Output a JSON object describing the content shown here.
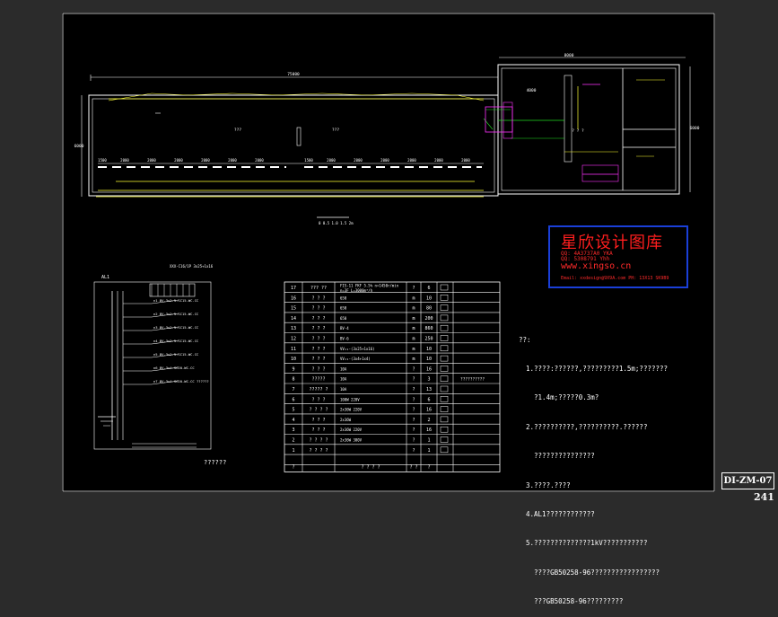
{
  "watermark": {
    "title": "星欣设计图库",
    "line1": "QQ: 4A3737A0 YKA",
    "line2": "QQ: 5308791 Yhh",
    "url": "www.xingso.cn",
    "email": "Email: xxdesign@9X9A.com  PH: 13X13 SK9B9"
  },
  "plan": {
    "top_dim_left": "75000",
    "top_dim_right": "8000",
    "left_dim": "6000",
    "right_dim": "6000",
    "room_left": "???",
    "room_mid": "???",
    "room_right": "? ? ?",
    "sub_dim": "4000",
    "spacings": [
      "1500",
      "2000",
      "2000",
      "2000",
      "2000",
      "2000",
      "2000",
      "1500",
      "2000",
      "2000",
      "2000",
      "2000",
      "2000",
      "2000"
    ],
    "scale_label": "0  0.5 1.0 1.5  2m"
  },
  "notes": {
    "header": "??:",
    "lines": [
      "1.????:??????,?????????1.5m;???????",
      "  ?1.4m;?????0.3m?",
      "2.??????????,??????????.??????",
      "  ???????????????",
      "3.????.????",
      "4.AL1????????????",
      "5.??????????????1kV???????????",
      "  ????GB50258-96?????????????????",
      "  ???GB50258-96?????????"
    ]
  },
  "schedule": {
    "rows": [
      {
        "no": "17",
        "name": "??? ??",
        "spec": "FIS-11 FKF  5.5% n=1450r/min\nn=3F          L=3000m³/h",
        "unit": "?",
        "qty": "6"
      },
      {
        "no": "16",
        "name": "? ? ?",
        "spec": "650",
        "unit": "m",
        "qty": "10"
      },
      {
        "no": "15",
        "name": "? ? ?",
        "spec": "650",
        "unit": "m",
        "qty": "80"
      },
      {
        "no": "14",
        "name": "? ? ?",
        "spec": "650",
        "unit": "m",
        "qty": "200"
      },
      {
        "no": "13",
        "name": "? ? ?",
        "spec": "BV-4",
        "unit": "m",
        "qty": "860"
      },
      {
        "no": "12",
        "name": "? ? ?",
        "spec": "BV-6",
        "unit": "m",
        "qty": "250"
      },
      {
        "no": "11",
        "name": "? ? ?",
        "spec": "VV₂₂-(3x25+1x16)",
        "unit": "m",
        "qty": "10"
      },
      {
        "no": "10",
        "name": "? ? ?",
        "spec": "VV₂₂-(3x4+1x4)",
        "unit": "m",
        "qty": "10"
      },
      {
        "no": "9",
        "name": "? ? ?",
        "spec": "10A",
        "unit": "?",
        "qty": "16"
      },
      {
        "no": "8",
        "name": "?????",
        "spec": "10A",
        "unit": "?",
        "qty": "3"
      },
      {
        "no": "7",
        "name": "????? ?",
        "spec": "10A",
        "unit": "?",
        "qty": "13"
      },
      {
        "no": "6",
        "name": "? ? ?",
        "spec": "100W  220V",
        "unit": "?",
        "qty": "6"
      },
      {
        "no": "5",
        "name": "? ? ? ?",
        "spec": "2x36W 220V",
        "unit": "?",
        "qty": "16"
      },
      {
        "no": "4",
        "name": "? ? ?",
        "spec": "2x36W",
        "unit": "?",
        "qty": "2"
      },
      {
        "no": "3",
        "name": "? ? ?",
        "spec": "2x36W  220V",
        "unit": "?",
        "qty": "16"
      },
      {
        "no": "2",
        "name": "? ? ? ?",
        "spec": "2x36W  380V",
        "unit": "?",
        "qty": "1"
      },
      {
        "no": "1",
        "name": "? ? ? ?",
        "spec": "",
        "unit": "?",
        "qty": "1"
      }
    ],
    "remark": "??????????",
    "footer": [
      "?",
      "? ? ? ?",
      "? ?",
      "?"
    ]
  },
  "schematic": {
    "panel_id": "AL1",
    "caption": "??????",
    "top_label": "XXX-C16/1P 3x25+1x16",
    "circuits": [
      "n1 BV-3x2.5-SC15-WC.CC",
      "n2 BV-3x2.5-SC15-WC.CC",
      "n3 BV-3x2.5-SC15-WC.CC",
      "n4 BV-3x2.5-SC15-WC.CC",
      "n5 BV-3x2.5-SC15-WC.CC",
      "n6 BV-3x4-SC20-WC.CC",
      "n7 BV-3x4-SC20-WC.CC  ??????"
    ]
  },
  "title_block": {
    "drawing_no": "DI-ZM-07",
    "page": "241"
  }
}
